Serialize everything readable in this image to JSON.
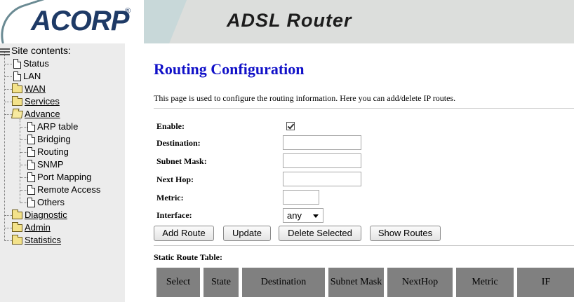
{
  "header": {
    "logo_text": "ACORP",
    "logo_reg": "®",
    "title": "ADSL Router"
  },
  "sidebar": {
    "root_label": "Site contents:",
    "items": [
      {
        "label": "Status",
        "icon": "document-icon",
        "link": false
      },
      {
        "label": "LAN",
        "icon": "document-icon",
        "link": false
      },
      {
        "label": "WAN",
        "icon": "folder-icon",
        "link": true
      },
      {
        "label": "Services",
        "icon": "folder-icon",
        "link": true
      },
      {
        "label": "Advance",
        "icon": "folder-open-icon",
        "link": true
      },
      {
        "label": "ARP table",
        "icon": "document-icon",
        "link": false
      },
      {
        "label": "Bridging",
        "icon": "document-icon",
        "link": false
      },
      {
        "label": "Routing",
        "icon": "document-icon",
        "link": false
      },
      {
        "label": "SNMP",
        "icon": "document-icon",
        "link": false
      },
      {
        "label": "Port Mapping",
        "icon": "document-icon",
        "link": false
      },
      {
        "label": "Remote Access",
        "icon": "document-icon",
        "link": false
      },
      {
        "label": "Others",
        "icon": "document-icon",
        "link": false
      },
      {
        "label": "Diagnostic",
        "icon": "folder-icon",
        "link": true
      },
      {
        "label": "Admin",
        "icon": "folder-icon",
        "link": true
      },
      {
        "label": "Statistics",
        "icon": "folder-icon",
        "link": true
      }
    ]
  },
  "main": {
    "title": "Routing Configuration",
    "description": "This page is used to configure the routing information. Here you can add/delete IP routes.",
    "form": {
      "enable_label": "Enable:",
      "enable_checked": true,
      "destination_label": "Destination:",
      "destination_value": "",
      "subnet_label": "Subnet Mask:",
      "subnet_value": "",
      "nexthop_label": "Next Hop:",
      "nexthop_value": "",
      "metric_label": "Metric:",
      "metric_value": "",
      "interface_label": "Interface:",
      "interface_value": "any"
    },
    "buttons": {
      "add": "Add Route",
      "update": "Update",
      "delete": "Delete Selected",
      "show": "Show Routes"
    },
    "table": {
      "title": "Static Route Table:",
      "columns": [
        "Select",
        "State",
        "Destination",
        "Subnet Mask",
        "NextHop",
        "Metric",
        "IF"
      ]
    }
  }
}
